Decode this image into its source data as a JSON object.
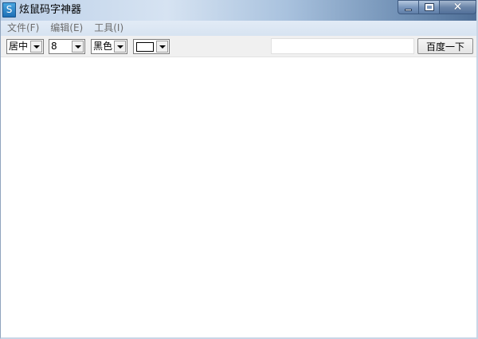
{
  "window": {
    "icon_label": "S",
    "title": "炫鼠码字神器"
  },
  "menubar": {
    "items": [
      {
        "label": "文件(F)"
      },
      {
        "label": "编辑(E)"
      },
      {
        "label": "工具(I)"
      }
    ]
  },
  "toolbar": {
    "alignment": {
      "value": "居中"
    },
    "font_size": {
      "value": "8"
    },
    "text_color": {
      "value": "黑色"
    },
    "background_color": {
      "swatch": "#ffffff"
    },
    "search": {
      "value": "",
      "placeholder": ""
    },
    "search_button_label": "百度一下"
  }
}
